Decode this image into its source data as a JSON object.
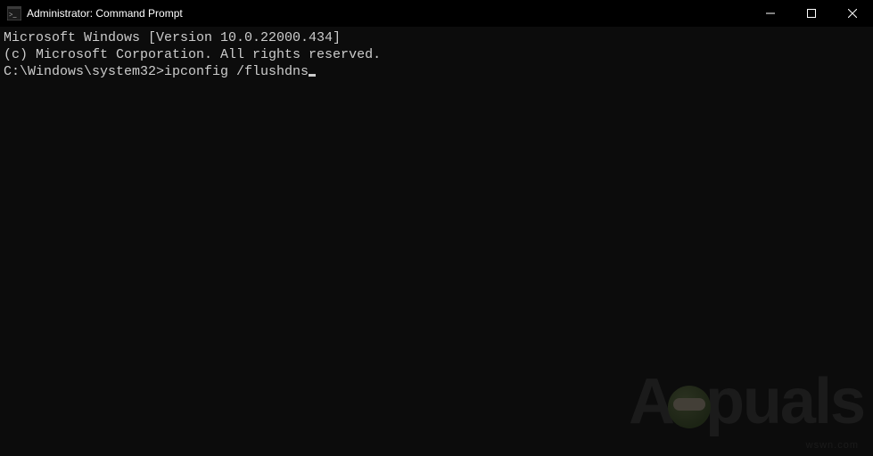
{
  "titlebar": {
    "title": "Administrator: Command Prompt"
  },
  "terminal": {
    "line1": "Microsoft Windows [Version 10.0.22000.434]",
    "line2": "(c) Microsoft Corporation. All rights reserved.",
    "blank": "",
    "prompt": "C:\\Windows\\system32>",
    "command": "ipconfig /flushdns"
  },
  "watermark": {
    "left_text": "A",
    "right_text": "puals",
    "sub": "wswn.com"
  }
}
